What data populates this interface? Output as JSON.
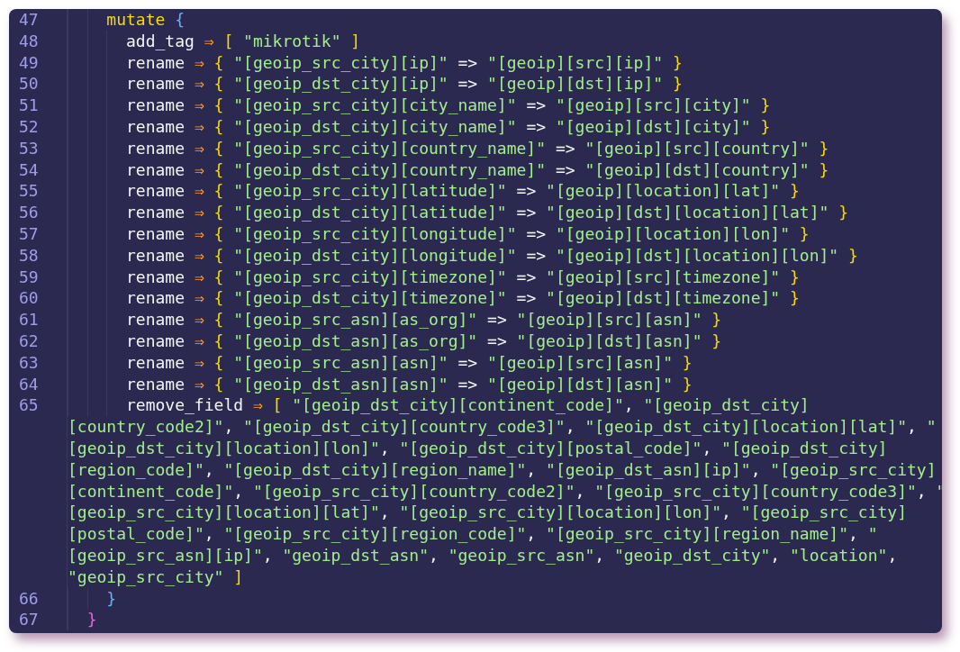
{
  "editor": {
    "lines": [
      {
        "kind": "group",
        "children": [
          {
            "kind": "line",
            "number": "47",
            "tokens": [
              {
                "kind": "block",
                "text": "mutate"
              },
              {
                "kind": "brace",
                "text": "{"
              }
            ],
            "children": [
              {
                "kind": "line",
                "number": "48",
                "tokens": [
                  {
                    "kind": "plain",
                    "text": "add_tag"
                  },
                  {
                    "kind": "arrow",
                    "text": "⇒"
                  },
                  {
                    "kind": "bracket",
                    "text": "["
                  },
                  {
                    "kind": "string",
                    "text": "\"mikrotik\""
                  },
                  {
                    "kind": "bracket",
                    "text": "]"
                  }
                ]
              },
              {
                "kind": "line",
                "number": "49",
                "tokens": [
                  {
                    "kind": "plain",
                    "text": "rename"
                  },
                  {
                    "kind": "arrow",
                    "text": "⇒"
                  },
                  {
                    "kind": "bracket",
                    "text": "{"
                  },
                  {
                    "kind": "string",
                    "text": "\"[geoip_src_city][ip]\""
                  },
                  {
                    "kind": "operator",
                    "text": "=>"
                  },
                  {
                    "kind": "string",
                    "text": "\"[geoip][src][ip]\""
                  },
                  {
                    "kind": "bracket",
                    "text": "}"
                  }
                ]
              },
              {
                "kind": "line",
                "number": "50",
                "tokens": [
                  {
                    "kind": "plain",
                    "text": "rename"
                  },
                  {
                    "kind": "arrow",
                    "text": "⇒"
                  },
                  {
                    "kind": "bracket",
                    "text": "{"
                  },
                  {
                    "kind": "string",
                    "text": "\"[geoip_dst_city][ip]\""
                  },
                  {
                    "kind": "operator",
                    "text": "=>"
                  },
                  {
                    "kind": "string",
                    "text": "\"[geoip][dst][ip]\""
                  },
                  {
                    "kind": "bracket",
                    "text": "}"
                  }
                ]
              },
              {
                "kind": "line",
                "number": "51",
                "tokens": [
                  {
                    "kind": "plain",
                    "text": "rename"
                  },
                  {
                    "kind": "arrow",
                    "text": "⇒"
                  },
                  {
                    "kind": "bracket",
                    "text": "{"
                  },
                  {
                    "kind": "string",
                    "text": "\"[geoip_src_city][city_name]\""
                  },
                  {
                    "kind": "operator",
                    "text": "=>"
                  },
                  {
                    "kind": "string",
                    "text": "\"[geoip][src][city]\""
                  },
                  {
                    "kind": "bracket",
                    "text": "}"
                  }
                ]
              },
              {
                "kind": "line",
                "number": "52",
                "tokens": [
                  {
                    "kind": "plain",
                    "text": "rename"
                  },
                  {
                    "kind": "arrow",
                    "text": "⇒"
                  },
                  {
                    "kind": "bracket",
                    "text": "{"
                  },
                  {
                    "kind": "string",
                    "text": "\"[geoip_dst_city][city_name]\""
                  },
                  {
                    "kind": "operator",
                    "text": "=>"
                  },
                  {
                    "kind": "string",
                    "text": "\"[geoip][dst][city]\""
                  },
                  {
                    "kind": "bracket",
                    "text": "}"
                  }
                ]
              },
              {
                "kind": "line",
                "number": "53",
                "tokens": [
                  {
                    "kind": "plain",
                    "text": "rename"
                  },
                  {
                    "kind": "arrow",
                    "text": "⇒"
                  },
                  {
                    "kind": "bracket",
                    "text": "{"
                  },
                  {
                    "kind": "string",
                    "text": "\"[geoip_src_city][country_name]\""
                  },
                  {
                    "kind": "operator",
                    "text": "=>"
                  },
                  {
                    "kind": "string",
                    "text": "\"[geoip][src][country]\""
                  },
                  {
                    "kind": "bracket",
                    "text": "}"
                  }
                ]
              },
              {
                "kind": "line",
                "number": "54",
                "tokens": [
                  {
                    "kind": "plain",
                    "text": "rename"
                  },
                  {
                    "kind": "arrow",
                    "text": "⇒"
                  },
                  {
                    "kind": "bracket",
                    "text": "{"
                  },
                  {
                    "kind": "string",
                    "text": "\"[geoip_dst_city][country_name]\""
                  },
                  {
                    "kind": "operator",
                    "text": "=>"
                  },
                  {
                    "kind": "string",
                    "text": "\"[geoip][dst][country]\""
                  },
                  {
                    "kind": "bracket",
                    "text": "}"
                  }
                ]
              },
              {
                "kind": "line",
                "number": "55",
                "tokens": [
                  {
                    "kind": "plain",
                    "text": "rename"
                  },
                  {
                    "kind": "arrow",
                    "text": "⇒"
                  },
                  {
                    "kind": "bracket",
                    "text": "{"
                  },
                  {
                    "kind": "string",
                    "text": "\"[geoip_src_city][latitude]\""
                  },
                  {
                    "kind": "operator",
                    "text": "=>"
                  },
                  {
                    "kind": "string",
                    "text": "\"[geoip][location][lat]\""
                  },
                  {
                    "kind": "bracket",
                    "text": "}"
                  }
                ]
              },
              {
                "kind": "line",
                "number": "56",
                "tokens": [
                  {
                    "kind": "plain",
                    "text": "rename"
                  },
                  {
                    "kind": "arrow",
                    "text": "⇒"
                  },
                  {
                    "kind": "bracket",
                    "text": "{"
                  },
                  {
                    "kind": "string",
                    "text": "\"[geoip_dst_city][latitude]\""
                  },
                  {
                    "kind": "operator",
                    "text": "=>"
                  },
                  {
                    "kind": "string",
                    "text": "\"[geoip][dst][location][lat]\""
                  },
                  {
                    "kind": "bracket",
                    "text": "}"
                  }
                ]
              },
              {
                "kind": "line",
                "number": "57",
                "tokens": [
                  {
                    "kind": "plain",
                    "text": "rename"
                  },
                  {
                    "kind": "arrow",
                    "text": "⇒"
                  },
                  {
                    "kind": "bracket",
                    "text": "{"
                  },
                  {
                    "kind": "string",
                    "text": "\"[geoip_src_city][longitude]\""
                  },
                  {
                    "kind": "operator",
                    "text": "=>"
                  },
                  {
                    "kind": "string",
                    "text": "\"[geoip][location][lon]\""
                  },
                  {
                    "kind": "bracket",
                    "text": "}"
                  }
                ]
              },
              {
                "kind": "line",
                "number": "58",
                "tokens": [
                  {
                    "kind": "plain",
                    "text": "rename"
                  },
                  {
                    "kind": "arrow",
                    "text": "⇒"
                  },
                  {
                    "kind": "bracket",
                    "text": "{"
                  },
                  {
                    "kind": "string",
                    "text": "\"[geoip_dst_city][longitude]\""
                  },
                  {
                    "kind": "operator",
                    "text": "=>"
                  },
                  {
                    "kind": "string",
                    "text": "\"[geoip][dst][location][lon]\""
                  },
                  {
                    "kind": "bracket",
                    "text": "}"
                  }
                ]
              },
              {
                "kind": "line",
                "number": "59",
                "tokens": [
                  {
                    "kind": "plain",
                    "text": "rename"
                  },
                  {
                    "kind": "arrow",
                    "text": "⇒"
                  },
                  {
                    "kind": "bracket",
                    "text": "{"
                  },
                  {
                    "kind": "string",
                    "text": "\"[geoip_src_city][timezone]\""
                  },
                  {
                    "kind": "operator",
                    "text": "=>"
                  },
                  {
                    "kind": "string",
                    "text": "\"[geoip][src][timezone]\""
                  },
                  {
                    "kind": "bracket",
                    "text": "}"
                  }
                ]
              },
              {
                "kind": "line",
                "number": "60",
                "tokens": [
                  {
                    "kind": "plain",
                    "text": "rename"
                  },
                  {
                    "kind": "arrow",
                    "text": "⇒"
                  },
                  {
                    "kind": "bracket",
                    "text": "{"
                  },
                  {
                    "kind": "string",
                    "text": "\"[geoip_dst_city][timezone]\""
                  },
                  {
                    "kind": "operator",
                    "text": "=>"
                  },
                  {
                    "kind": "string",
                    "text": "\"[geoip][dst][timezone]\""
                  },
                  {
                    "kind": "bracket",
                    "text": "}"
                  }
                ]
              },
              {
                "kind": "line",
                "number": "61",
                "tokens": [
                  {
                    "kind": "plain",
                    "text": "rename"
                  },
                  {
                    "kind": "arrow",
                    "text": "⇒"
                  },
                  {
                    "kind": "bracket",
                    "text": "{"
                  },
                  {
                    "kind": "string",
                    "text": "\"[geoip_src_asn][as_org]\""
                  },
                  {
                    "kind": "operator",
                    "text": "=>"
                  },
                  {
                    "kind": "string",
                    "text": "\"[geoip][src][asn]\""
                  },
                  {
                    "kind": "bracket",
                    "text": "}"
                  }
                ]
              },
              {
                "kind": "line",
                "number": "62",
                "tokens": [
                  {
                    "kind": "plain",
                    "text": "rename"
                  },
                  {
                    "kind": "arrow",
                    "text": "⇒"
                  },
                  {
                    "kind": "bracket",
                    "text": "{"
                  },
                  {
                    "kind": "string",
                    "text": "\"[geoip_dst_asn][as_org]\""
                  },
                  {
                    "kind": "operator",
                    "text": "=>"
                  },
                  {
                    "kind": "string",
                    "text": "\"[geoip][dst][asn]\""
                  },
                  {
                    "kind": "bracket",
                    "text": "}"
                  }
                ]
              },
              {
                "kind": "line",
                "number": "63",
                "tokens": [
                  {
                    "kind": "plain",
                    "text": "rename"
                  },
                  {
                    "kind": "arrow",
                    "text": "⇒"
                  },
                  {
                    "kind": "bracket",
                    "text": "{"
                  },
                  {
                    "kind": "string",
                    "text": "\"[geoip_src_asn][asn]\""
                  },
                  {
                    "kind": "operator",
                    "text": "=>"
                  },
                  {
                    "kind": "string",
                    "text": "\"[geoip][src][asn]\""
                  },
                  {
                    "kind": "bracket",
                    "text": "}"
                  }
                ]
              },
              {
                "kind": "line",
                "number": "64",
                "tokens": [
                  {
                    "kind": "plain",
                    "text": "rename"
                  },
                  {
                    "kind": "arrow",
                    "text": "⇒"
                  },
                  {
                    "kind": "bracket",
                    "text": "{"
                  },
                  {
                    "kind": "string",
                    "text": "\"[geoip_dst_asn][asn]\""
                  },
                  {
                    "kind": "operator",
                    "text": "=>"
                  },
                  {
                    "kind": "string",
                    "text": "\"[geoip][dst][asn]\""
                  },
                  {
                    "kind": "bracket",
                    "text": "}"
                  }
                ]
              },
              {
                "kind": "line",
                "number": "65",
                "tokens": [
                  {
                    "kind": "plain",
                    "text": "remove_field"
                  },
                  {
                    "kind": "arrow",
                    "text": "⇒"
                  },
                  {
                    "kind": "bracket",
                    "text": "["
                  },
                  {
                    "kind": "string",
                    "text": "\"[geoip_dst_city][continent_code]\""
                  },
                  {
                    "kind": "punct",
                    "text": ","
                  },
                  {
                    "kind": "string",
                    "text": "\"[geoip_dst_city]"
                  }
                ],
                "continuation": [
                  [
                    {
                      "kind": "string",
                      "text": "[country_code2]\""
                    },
                    {
                      "kind": "punct",
                      "text": ","
                    },
                    {
                      "kind": "string",
                      "text": "\"[geoip_dst_city][country_code3]\""
                    },
                    {
                      "kind": "punct",
                      "text": ","
                    },
                    {
                      "kind": "string",
                      "text": "\"[geoip_dst_city][location][lat]\""
                    },
                    {
                      "kind": "punct",
                      "text": ","
                    },
                    {
                      "kind": "string",
                      "text": "\""
                    }
                  ],
                  [
                    {
                      "kind": "string",
                      "text": "[geoip_dst_city][location][lon]\""
                    },
                    {
                      "kind": "punct",
                      "text": ","
                    },
                    {
                      "kind": "string",
                      "text": "\"[geoip_dst_city][postal_code]\""
                    },
                    {
                      "kind": "punct",
                      "text": ","
                    },
                    {
                      "kind": "string",
                      "text": "\"[geoip_dst_city]"
                    }
                  ],
                  [
                    {
                      "kind": "string",
                      "text": "[region_code]\""
                    },
                    {
                      "kind": "punct",
                      "text": ","
                    },
                    {
                      "kind": "string",
                      "text": "\"[geoip_dst_city][region_name]\""
                    },
                    {
                      "kind": "punct",
                      "text": ","
                    },
                    {
                      "kind": "string",
                      "text": "\"[geoip_dst_asn][ip]\""
                    },
                    {
                      "kind": "punct",
                      "text": ","
                    },
                    {
                      "kind": "string",
                      "text": "\"[geoip_src_city]"
                    }
                  ],
                  [
                    {
                      "kind": "string",
                      "text": "[continent_code]\""
                    },
                    {
                      "kind": "punct",
                      "text": ","
                    },
                    {
                      "kind": "string",
                      "text": "\"[geoip_src_city][country_code2]\""
                    },
                    {
                      "kind": "punct",
                      "text": ","
                    },
                    {
                      "kind": "string",
                      "text": "\"[geoip_src_city][country_code3]\""
                    },
                    {
                      "kind": "punct",
                      "text": ","
                    },
                    {
                      "kind": "string",
                      "text": "\""
                    }
                  ],
                  [
                    {
                      "kind": "string",
                      "text": "[geoip_src_city][location][lat]\""
                    },
                    {
                      "kind": "punct",
                      "text": ","
                    },
                    {
                      "kind": "string",
                      "text": "\"[geoip_src_city][location][lon]\""
                    },
                    {
                      "kind": "punct",
                      "text": ","
                    },
                    {
                      "kind": "string",
                      "text": "\"[geoip_src_city]"
                    }
                  ],
                  [
                    {
                      "kind": "string",
                      "text": "[postal_code]\""
                    },
                    {
                      "kind": "punct",
                      "text": ","
                    },
                    {
                      "kind": "string",
                      "text": "\"[geoip_src_city][region_code]\""
                    },
                    {
                      "kind": "punct",
                      "text": ","
                    },
                    {
                      "kind": "string",
                      "text": "\"[geoip_src_city][region_name]\""
                    },
                    {
                      "kind": "punct",
                      "text": ","
                    },
                    {
                      "kind": "string",
                      "text": "\""
                    }
                  ],
                  [
                    {
                      "kind": "string",
                      "text": "[geoip_src_asn][ip]\""
                    },
                    {
                      "kind": "punct",
                      "text": ","
                    },
                    {
                      "kind": "string",
                      "text": "\"geoip_dst_asn\""
                    },
                    {
                      "kind": "punct",
                      "text": ","
                    },
                    {
                      "kind": "string",
                      "text": "\"geoip_src_asn\""
                    },
                    {
                      "kind": "punct",
                      "text": ","
                    },
                    {
                      "kind": "string",
                      "text": "\"geoip_dst_city\""
                    },
                    {
                      "kind": "punct",
                      "text": ","
                    },
                    {
                      "kind": "string",
                      "text": "\"location\""
                    },
                    {
                      "kind": "punct",
                      "text": ","
                    }
                  ],
                  [
                    {
                      "kind": "string",
                      "text": "\"geoip_src_city\""
                    },
                    {
                      "kind": "bracket",
                      "text": "]"
                    }
                  ]
                ]
              }
            ]
          },
          {
            "kind": "line",
            "number": "66",
            "tokens": [
              {
                "kind": "brace",
                "text": "}"
              }
            ]
          }
        ]
      },
      {
        "kind": "line",
        "number": "67",
        "tokens": [
          {
            "kind": "outerbrace",
            "text": "}"
          }
        ]
      }
    ]
  }
}
